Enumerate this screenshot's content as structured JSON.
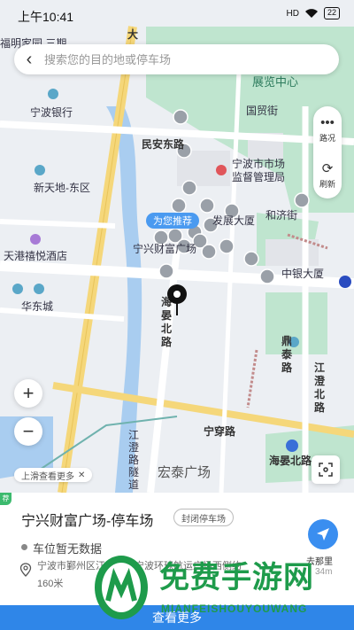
{
  "status_bar": {
    "time": "上午10:41",
    "signal": "HD",
    "battery": "22"
  },
  "search": {
    "placeholder": "搜索您的目的地或停车场"
  },
  "right_panel": {
    "route_label": "路况",
    "refresh_label": "刷新"
  },
  "map": {
    "recommend_tag": "为您推荐",
    "labels": {
      "label_1": "福明家园 三期",
      "label_2": "宁波银行",
      "label_3": "新天地-东区",
      "label_4": "天港禧悦酒店",
      "label_5": "华东城",
      "label_6": "展览中心",
      "label_7": "国贸街",
      "label_8": "民安东路",
      "label_9": "宁波市市场监督管理局",
      "label_10": "发展大厦",
      "label_11": "和济街",
      "label_12": "宁兴财富广场",
      "label_13": "中银大厦",
      "label_14": "海晏北路",
      "label_15": "鼎泰路",
      "label_16": "宁穿路",
      "label_17": "海晏北路",
      "label_18": "宏泰广场",
      "label_19": "江澄路隧道",
      "label_20": "江澄北路",
      "label_21": "大"
    },
    "hint": "上滑查看更多"
  },
  "sheet": {
    "corner_tag": "荐",
    "title": "宁兴财富广场-停车场",
    "status_chip": "封闭停车场",
    "availability": "车位暂无数据",
    "address": "宁波市鄞州区江澄北路宁波环球航运广场西侧约",
    "distance": "160米",
    "go_label": "去那里",
    "go_distance": "34m",
    "more_button": "查看更多"
  },
  "watermark": {
    "title": "免费手游网",
    "subtitle": "MIANFEISHOUYOUWANG"
  },
  "colors": {
    "accent": "#2f86e8",
    "green_areas": "#bfe5cf",
    "water": "#a9cdf0",
    "main_road": "#f5d77a",
    "watermark": "#1e9b4b"
  }
}
